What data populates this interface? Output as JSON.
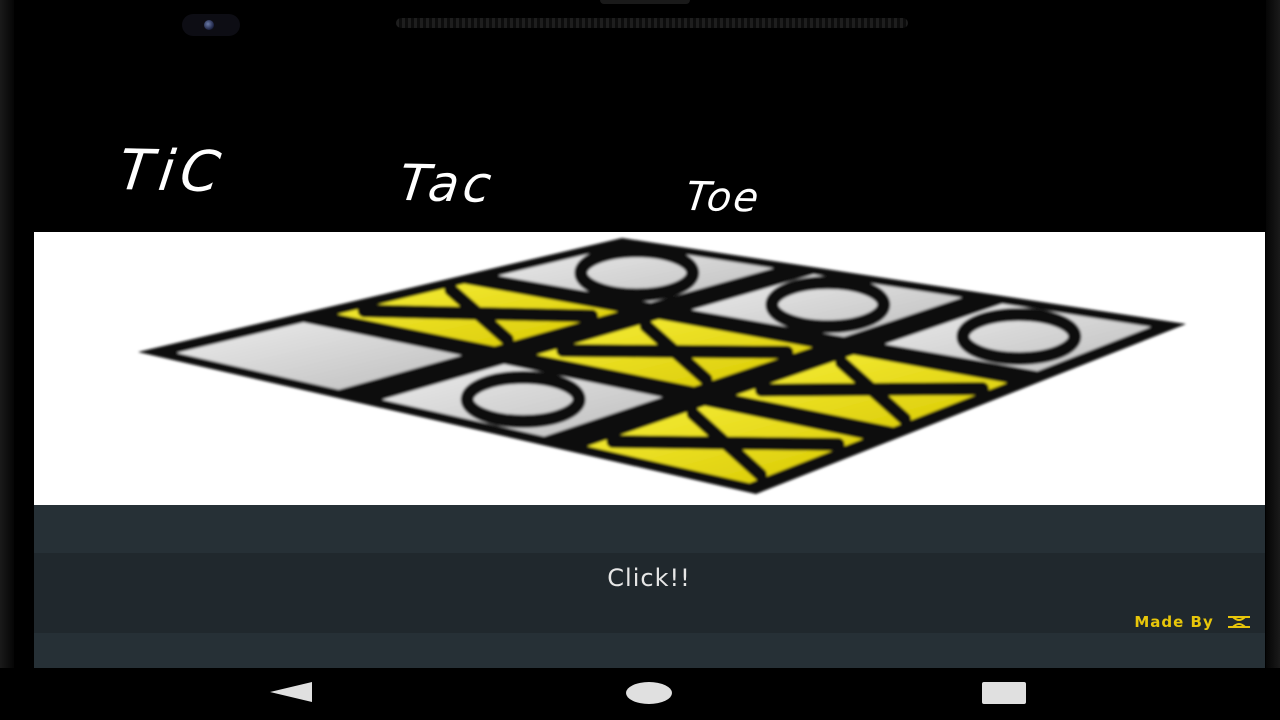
{
  "app": {
    "title_words": [
      "TiC",
      "Tac",
      "Toe"
    ]
  },
  "hero": {
    "board": [
      [
        "O",
        "O",
        "O"
      ],
      [
        "X",
        "X",
        "X"
      ],
      [
        "",
        "O",
        "X"
      ]
    ]
  },
  "actions": {
    "click_label": "Click!!"
  },
  "footer": {
    "made_by": "Made By",
    "accent_color": "#e8c60a"
  },
  "colors": {
    "background": "#000000",
    "hero_background": "#ffffff",
    "panel": "#263036",
    "board_yellow": "#ede10a",
    "board_gray": "#d6d6d6"
  },
  "icons": {
    "nav": [
      "back-triangle-icon",
      "home-circle-icon",
      "recents-square-icon"
    ]
  }
}
